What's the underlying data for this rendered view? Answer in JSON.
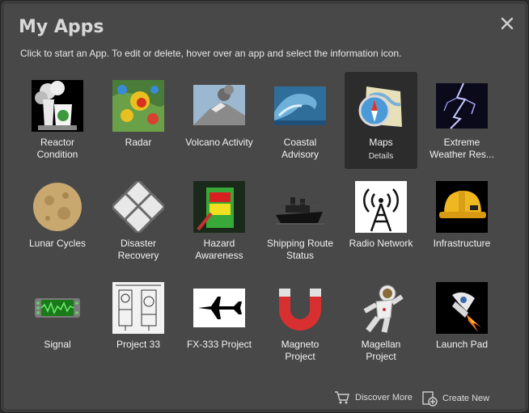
{
  "dialog": {
    "title": "My Apps",
    "subtitle": "Click to start an App. To edit or delete, hover over an app and select the information icon."
  },
  "apps": [
    {
      "label": "Reactor Condition",
      "icon": "reactor-icon"
    },
    {
      "label": "Radar",
      "icon": "radar-icon"
    },
    {
      "label": "Volcano Activity",
      "icon": "volcano-icon"
    },
    {
      "label": "Coastal Advisory",
      "icon": "wave-icon"
    },
    {
      "label": "Maps",
      "icon": "maps-icon",
      "details": "Details"
    },
    {
      "label": "Extreme Weather Res...",
      "icon": "lightning-icon"
    },
    {
      "label": "Lunar Cycles",
      "icon": "moon-icon"
    },
    {
      "label": "Disaster Recovery",
      "icon": "disaster-icon"
    },
    {
      "label": "Hazard Awareness",
      "icon": "hazard-icon"
    },
    {
      "label": "Shipping Route Status",
      "icon": "ship-icon"
    },
    {
      "label": "Radio Network",
      "icon": "radio-tower-icon"
    },
    {
      "label": "Infrastructure",
      "icon": "hardhat-icon"
    },
    {
      "label": "Signal",
      "icon": "signal-icon"
    },
    {
      "label": "Project 33",
      "icon": "blueprint-icon"
    },
    {
      "label": "FX-333 Project",
      "icon": "jet-icon"
    },
    {
      "label": "Magneto Project",
      "icon": "magnet-icon"
    },
    {
      "label": "Magellan Project",
      "icon": "astronaut-icon"
    },
    {
      "label": "Launch Pad",
      "icon": "rocket-icon"
    }
  ],
  "footer": {
    "discover_label": "Discover More",
    "create_label": "Create New"
  }
}
